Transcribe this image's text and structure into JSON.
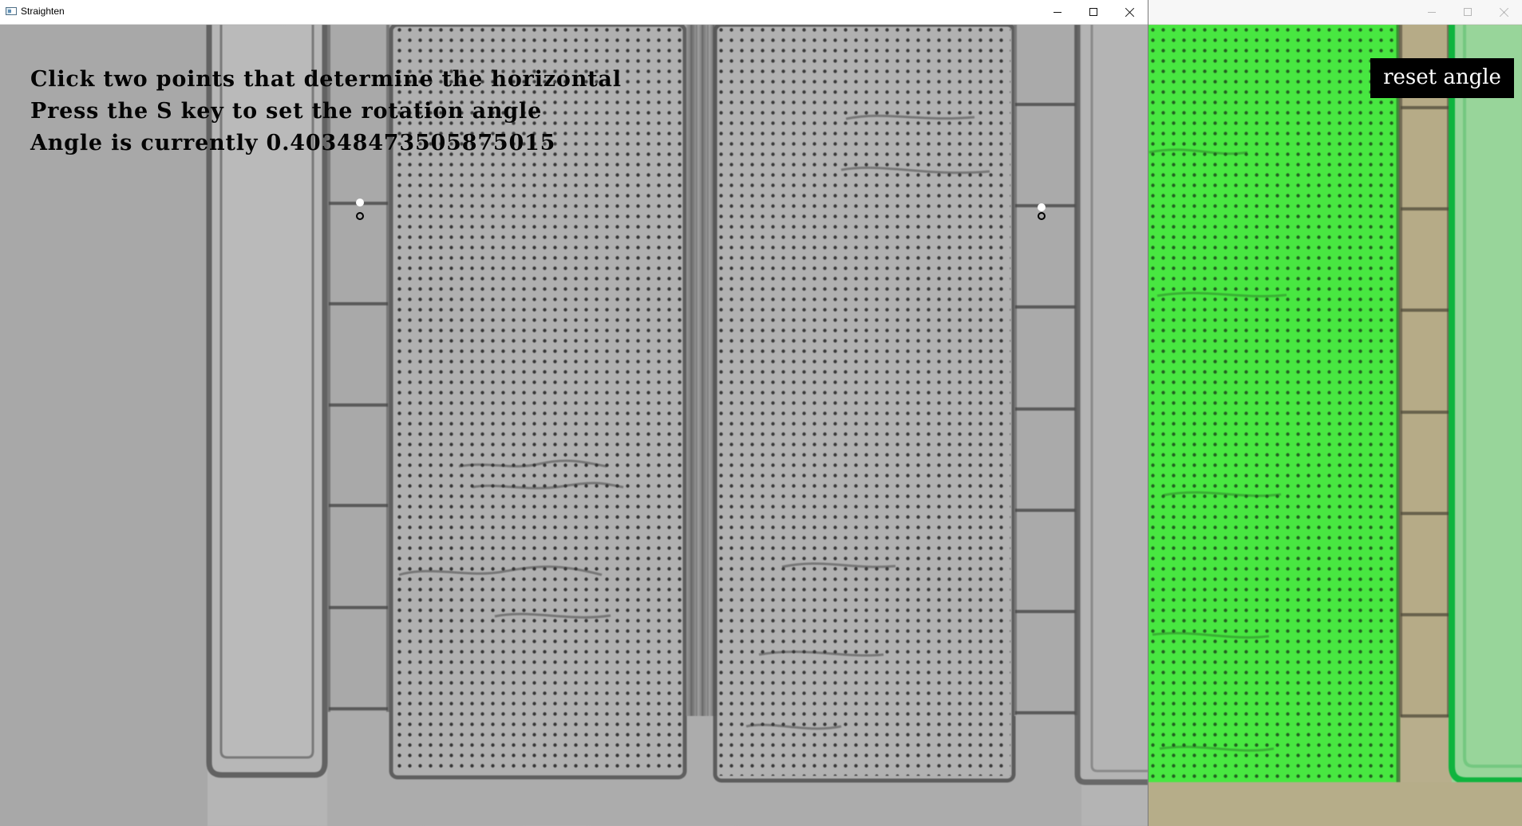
{
  "main_window": {
    "title": "Straighten",
    "instructions": [
      "Click two points that determine the horizontal",
      "Press the S key to set the rotation angle",
      "Angle is currently 0.40348473505875015"
    ]
  },
  "secondary_window": {
    "reset_label": "reset angle"
  },
  "colors": {
    "main_background": "#a9a9a9",
    "microscope_gray": "#b0b0b0",
    "grid_dots": "#1f1f1f",
    "overlay_text": "#050505",
    "green_panel": "#46e33f",
    "tan_background": "#b7ae8e",
    "button_background": "#000000",
    "button_text": "#ffffff"
  },
  "icons": {
    "window_app": "app-window-icon",
    "minimize": "minimize-icon",
    "maximize": "maximize-icon",
    "close": "close-icon",
    "selected_point": "selection-point-icon"
  }
}
